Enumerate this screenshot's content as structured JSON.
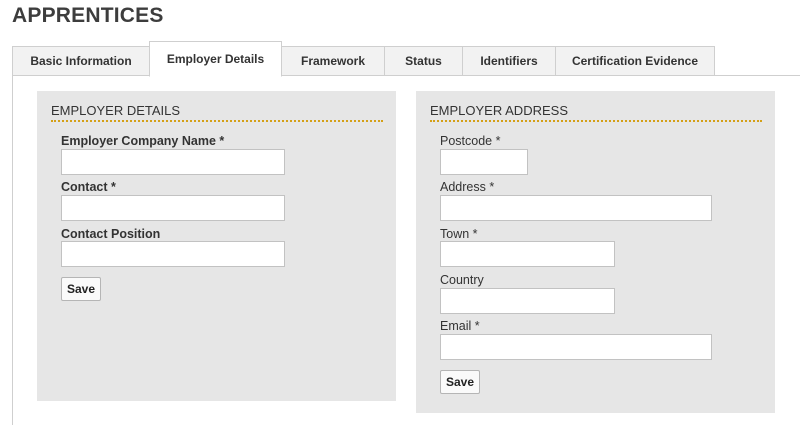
{
  "page": {
    "title": "APPRENTICES"
  },
  "tabs": [
    {
      "label": "Basic Information",
      "active": false
    },
    {
      "label": "Employer Details",
      "active": true
    },
    {
      "label": "Framework",
      "active": false
    },
    {
      "label": "Status",
      "active": false
    },
    {
      "label": "Identifiers",
      "active": false
    },
    {
      "label": "Certification Evidence",
      "active": false
    }
  ],
  "employer_details": {
    "heading": "EMPLOYER DETAILS",
    "fields": [
      {
        "label": "Employer Company Name *",
        "value": ""
      },
      {
        "label": "Contact *",
        "value": ""
      },
      {
        "label": "Contact Position",
        "value": ""
      }
    ],
    "save_label": "Save"
  },
  "employer_address": {
    "heading": "EMPLOYER ADDRESS",
    "fields": [
      {
        "label": "Postcode *",
        "value": ""
      },
      {
        "label": "Address *",
        "value": ""
      },
      {
        "label": "Town *",
        "value": ""
      },
      {
        "label": "Country",
        "value": ""
      },
      {
        "label": "Email *",
        "value": ""
      }
    ],
    "save_label": "Save"
  },
  "colors": {
    "panel_bg": "#e6e6e6",
    "heading_rule": "#d4a017",
    "tab_bg": "#f2f2f2"
  }
}
